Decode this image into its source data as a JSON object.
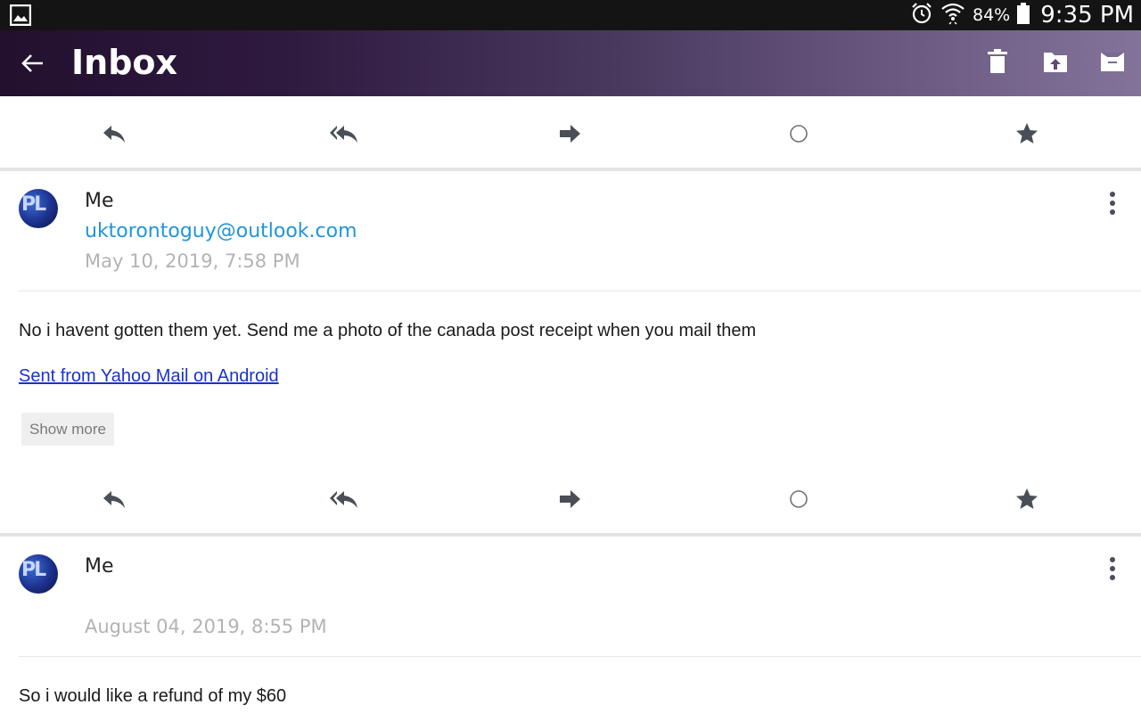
{
  "status_bar": {
    "battery_text": "84%",
    "time": "9:35 PM",
    "icons": [
      "gallery-icon",
      "alarm-icon",
      "wifi-icon",
      "battery-icon"
    ]
  },
  "app_bar": {
    "title": "Inbox",
    "icons": [
      "back-arrow-icon",
      "delete-icon",
      "move-to-folder-icon",
      "archive-icon"
    ]
  },
  "action_icons": [
    "reply-icon",
    "reply-all-icon",
    "forward-icon",
    "mark-unread-icon",
    "star-icon"
  ],
  "messages": [
    {
      "sender": "Me",
      "email": "uktorontoguy@outlook.com",
      "date": "May 10, 2019, 7:58 PM",
      "avatar_text": "PL",
      "body": "No i havent gotten them yet. Send me a photo of the canada post receipt when you mail them",
      "signature_link": "Sent from Yahoo Mail on Android",
      "show_more_label": "Show more"
    },
    {
      "sender": "Me",
      "email": "",
      "date": "August 04, 2019, 8:55 PM",
      "avatar_text": "PL",
      "body": "So i would like a refund of my $60"
    }
  ],
  "colors": {
    "app_bar_gradient_start": "#22102e",
    "app_bar_gradient_end": "#83739a",
    "icon_gray": "#4a4f57",
    "email_link": "#2196d9",
    "signature_link": "#1a33c8"
  }
}
